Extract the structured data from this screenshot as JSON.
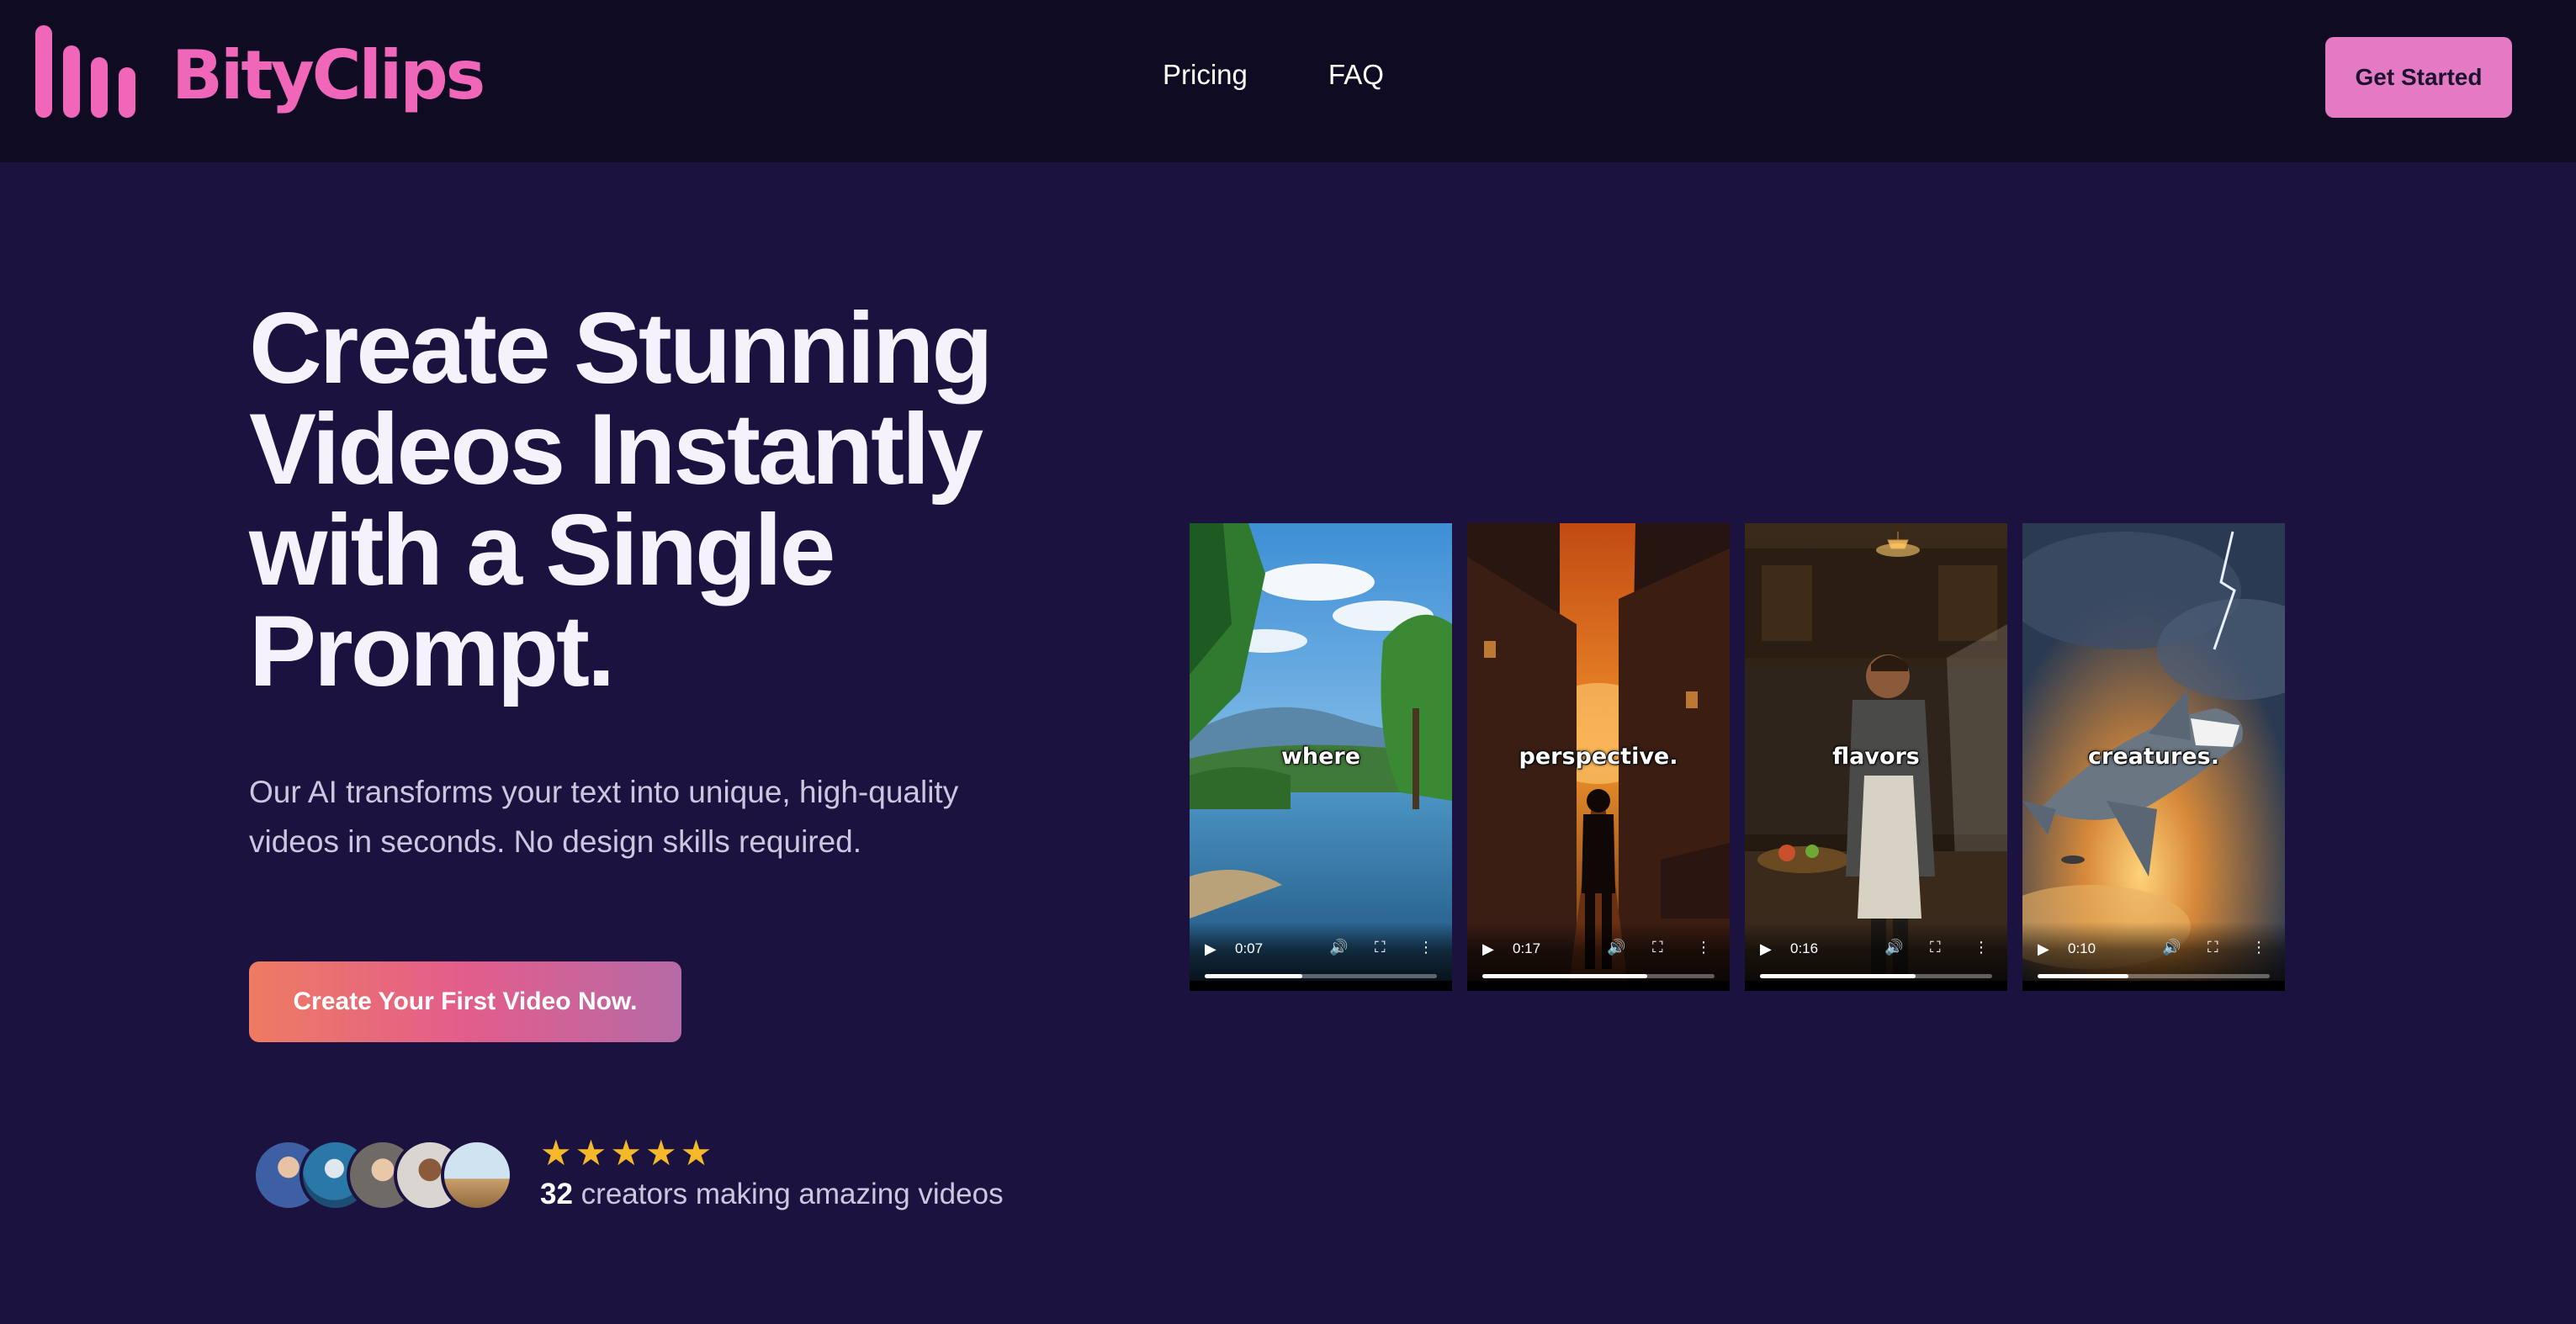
{
  "header": {
    "brand": "BityClips",
    "nav": [
      {
        "label": "Pricing"
      },
      {
        "label": "FAQ"
      }
    ],
    "cta_label": "Get Started"
  },
  "hero": {
    "title_lines": [
      "Create Stunning",
      "Videos Instantly",
      "with a Single",
      "Prompt."
    ],
    "subtitle_lines": [
      "Our AI transforms your text into unique, high-quality",
      "videos in seconds. No design skills required."
    ],
    "cta_label": "Create Your First Video Now."
  },
  "social_proof": {
    "rating_stars": 5,
    "count": "32",
    "text": "creators making amazing videos"
  },
  "videos": [
    {
      "caption": "where",
      "time": "0:07",
      "progress": 0.42
    },
    {
      "caption": "perspective.",
      "time": "0:17",
      "progress": 0.71
    },
    {
      "caption": "flavors",
      "time": "0:16",
      "progress": 0.67
    },
    {
      "caption": "creatures.",
      "time": "0:10",
      "progress": 0.39
    }
  ],
  "colors": {
    "brand_pink": "#f066b8",
    "page_bg": "#1c1240",
    "header_bg": "#0f0b22",
    "star": "#f5b82a",
    "cta_gradient_start": "#ee7b62",
    "cta_gradient_end": "#b66aa6"
  }
}
